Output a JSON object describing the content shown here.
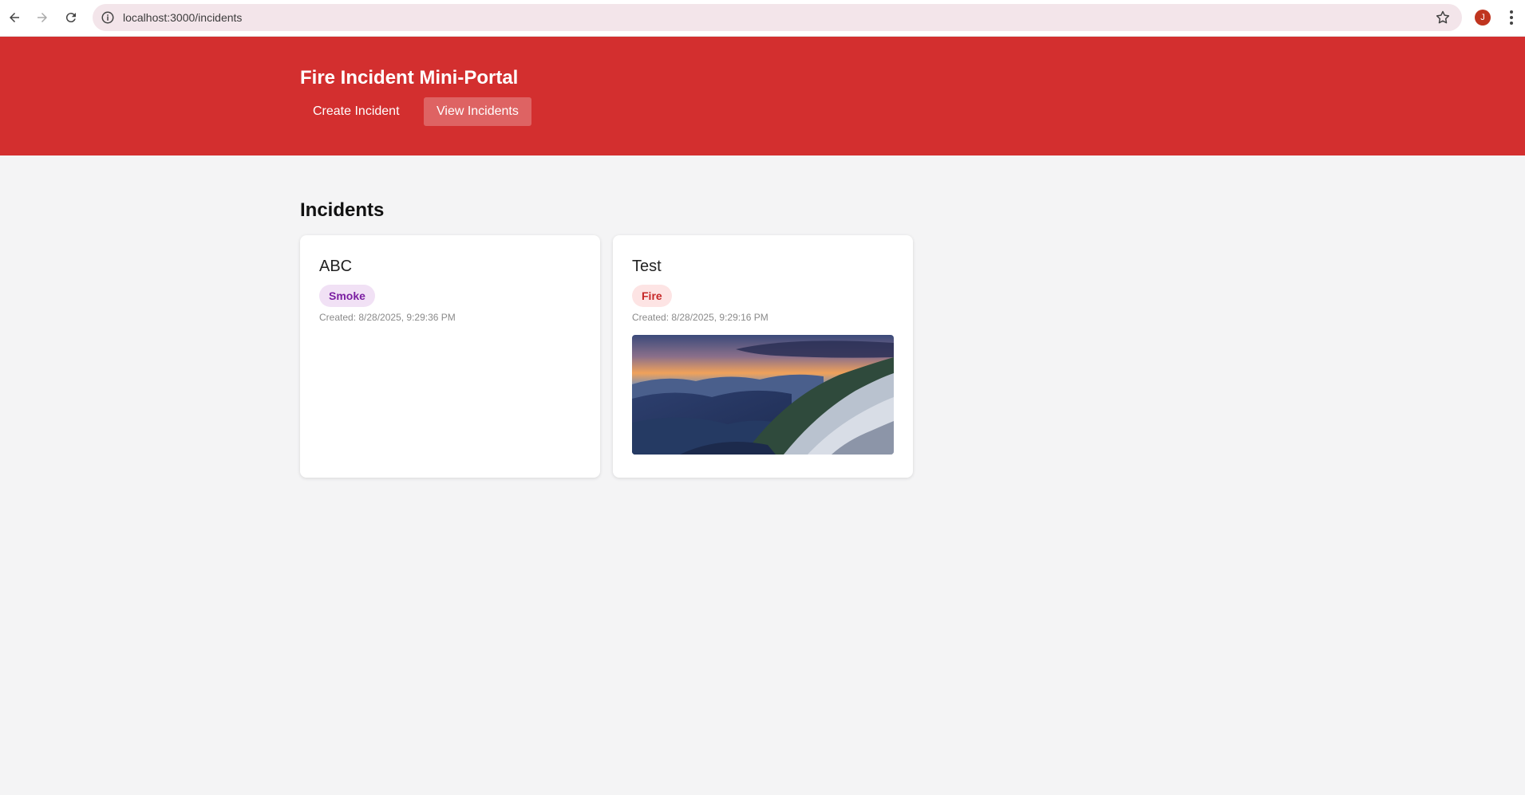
{
  "browser": {
    "url": "localhost:3000/incidents",
    "avatar_letter": "J"
  },
  "header": {
    "title": "Fire Incident Mini-Portal",
    "nav": {
      "create_label": "Create Incident",
      "view_label": "View Incidents"
    },
    "accent_color": "#d32f2f"
  },
  "main": {
    "section_title": "Incidents",
    "incidents": [
      {
        "title": "ABC",
        "type": "Smoke",
        "created": "Created: 8/28/2025, 9:29:36 PM"
      },
      {
        "title": "Test",
        "type": "Fire",
        "created": "Created: 8/28/2025, 9:29:16 PM",
        "image": "mountain-landscape-photo"
      }
    ]
  }
}
